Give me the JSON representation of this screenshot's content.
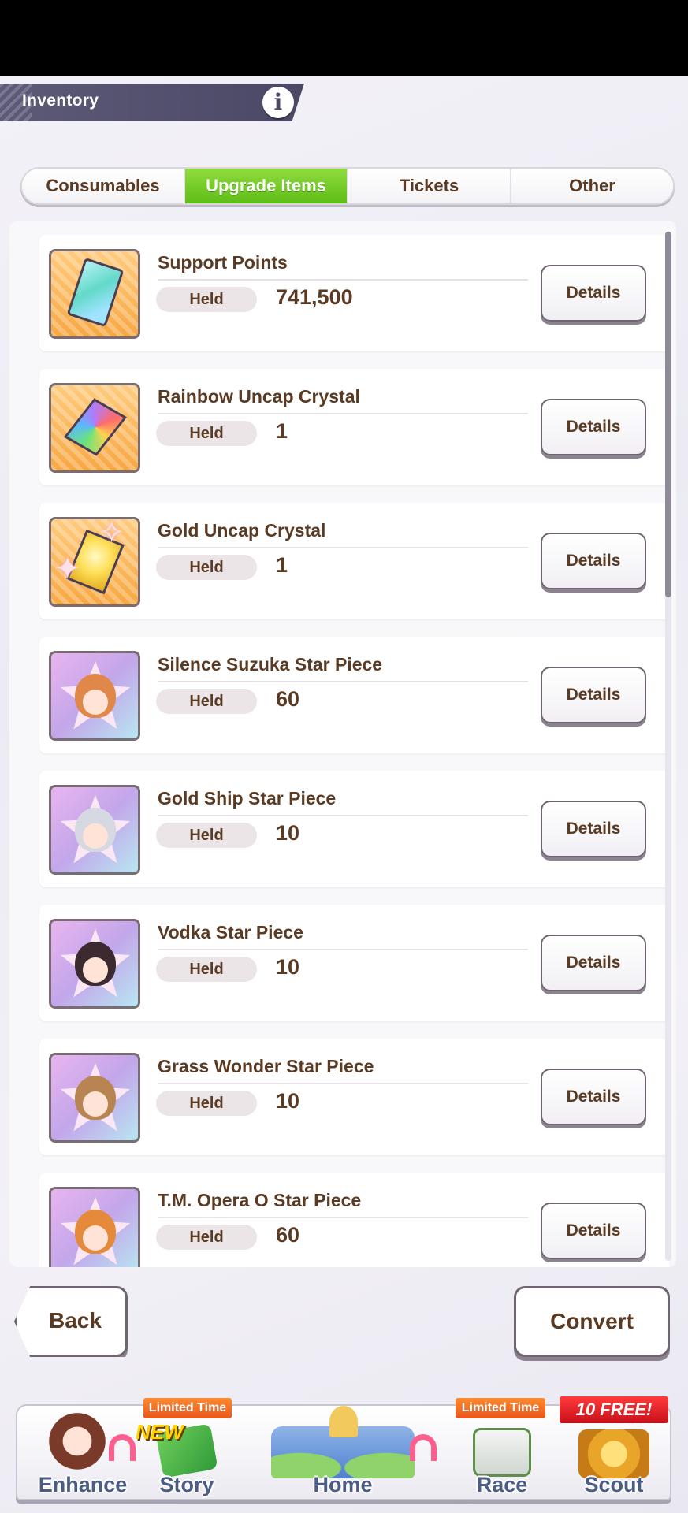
{
  "header": {
    "title": "Inventory",
    "info_label": "i"
  },
  "tabs": [
    {
      "label": "Consumables",
      "active": false
    },
    {
      "label": "Upgrade Items",
      "active": true
    },
    {
      "label": "Tickets",
      "active": false
    },
    {
      "label": "Other",
      "active": false
    }
  ],
  "items": [
    {
      "name": "Support Points",
      "held_label": "Held",
      "held_value": "741,500",
      "details_label": "Details",
      "icon": "support-points-card-icon"
    },
    {
      "name": "Rainbow Uncap Crystal",
      "held_label": "Held",
      "held_value": "1",
      "details_label": "Details",
      "icon": "rainbow-crystal-icon"
    },
    {
      "name": "Gold Uncap Crystal",
      "held_label": "Held",
      "held_value": "1",
      "details_label": "Details",
      "icon": "gold-crystal-icon"
    },
    {
      "name": "Silence Suzuka Star Piece",
      "held_label": "Held",
      "held_value": "60",
      "details_label": "Details",
      "icon": "star-piece-icon"
    },
    {
      "name": "Gold Ship Star Piece",
      "held_label": "Held",
      "held_value": "10",
      "details_label": "Details",
      "icon": "star-piece-icon"
    },
    {
      "name": "Vodka Star Piece",
      "held_label": "Held",
      "held_value": "10",
      "details_label": "Details",
      "icon": "star-piece-icon"
    },
    {
      "name": "Grass Wonder Star Piece",
      "held_label": "Held",
      "held_value": "10",
      "details_label": "Details",
      "icon": "star-piece-icon"
    },
    {
      "name": "T.M. Opera O Star Piece",
      "held_label": "Held",
      "held_value": "60",
      "details_label": "Details",
      "icon": "star-piece-icon"
    }
  ],
  "actions": {
    "back_label": "Back",
    "convert_label": "Convert"
  },
  "nav": {
    "enhance": {
      "label": "Enhance"
    },
    "story": {
      "label": "Story",
      "ribbon": "Limited Time",
      "badge": "NEW"
    },
    "home": {
      "label": "Home"
    },
    "race": {
      "label": "Race",
      "ribbon": "Limited Time"
    },
    "scout": {
      "label": "Scout",
      "ribbon": "10 FREE!"
    }
  },
  "colors": {
    "active_tab": "#6cc81f",
    "text_brown": "#5a3a22",
    "nav_label": "#4b5d86"
  }
}
